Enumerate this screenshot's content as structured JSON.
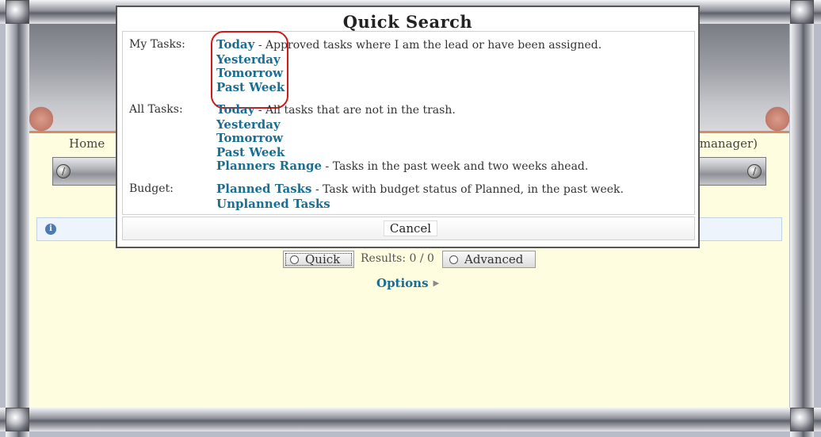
{
  "nav": {
    "home": "Home",
    "manager": "manager)"
  },
  "toolbar": {
    "quick_label": "Quick",
    "results": "Results: 0 / 0",
    "advanced_label": "Advanced",
    "options_label": "Options"
  },
  "info_strip": {
    "icon": "info-icon"
  },
  "dialog": {
    "title": "Quick Search",
    "cancel_label": "Cancel",
    "sections": {
      "my_tasks": {
        "label": "My Tasks:",
        "items": [
          {
            "link": "Today",
            "desc": " - Approved tasks where I am the lead or have been assigned."
          },
          {
            "link": "Yesterday",
            "desc": ""
          },
          {
            "link": "Tomorrow",
            "desc": ""
          },
          {
            "link": "Past Week",
            "desc": ""
          }
        ]
      },
      "all_tasks": {
        "label": "All Tasks:",
        "items": [
          {
            "link": "Today",
            "desc": " - All tasks that are not in the trash."
          },
          {
            "link": "Yesterday",
            "desc": ""
          },
          {
            "link": "Tomorrow",
            "desc": ""
          },
          {
            "link": "Past Week",
            "desc": ""
          },
          {
            "link": "Planners Range",
            "desc": " - Tasks in the past week and two weeks ahead."
          }
        ]
      },
      "budget": {
        "label": "Budget:",
        "items": [
          {
            "link": "Planned Tasks",
            "desc": " - Task with budget status of Planned, in the past week."
          },
          {
            "link": "Unplanned Tasks",
            "desc": ""
          }
        ]
      }
    }
  },
  "colors": {
    "link": "#1a6e94",
    "highlight": "#d21a1a",
    "content_bg": "#fffde0"
  }
}
